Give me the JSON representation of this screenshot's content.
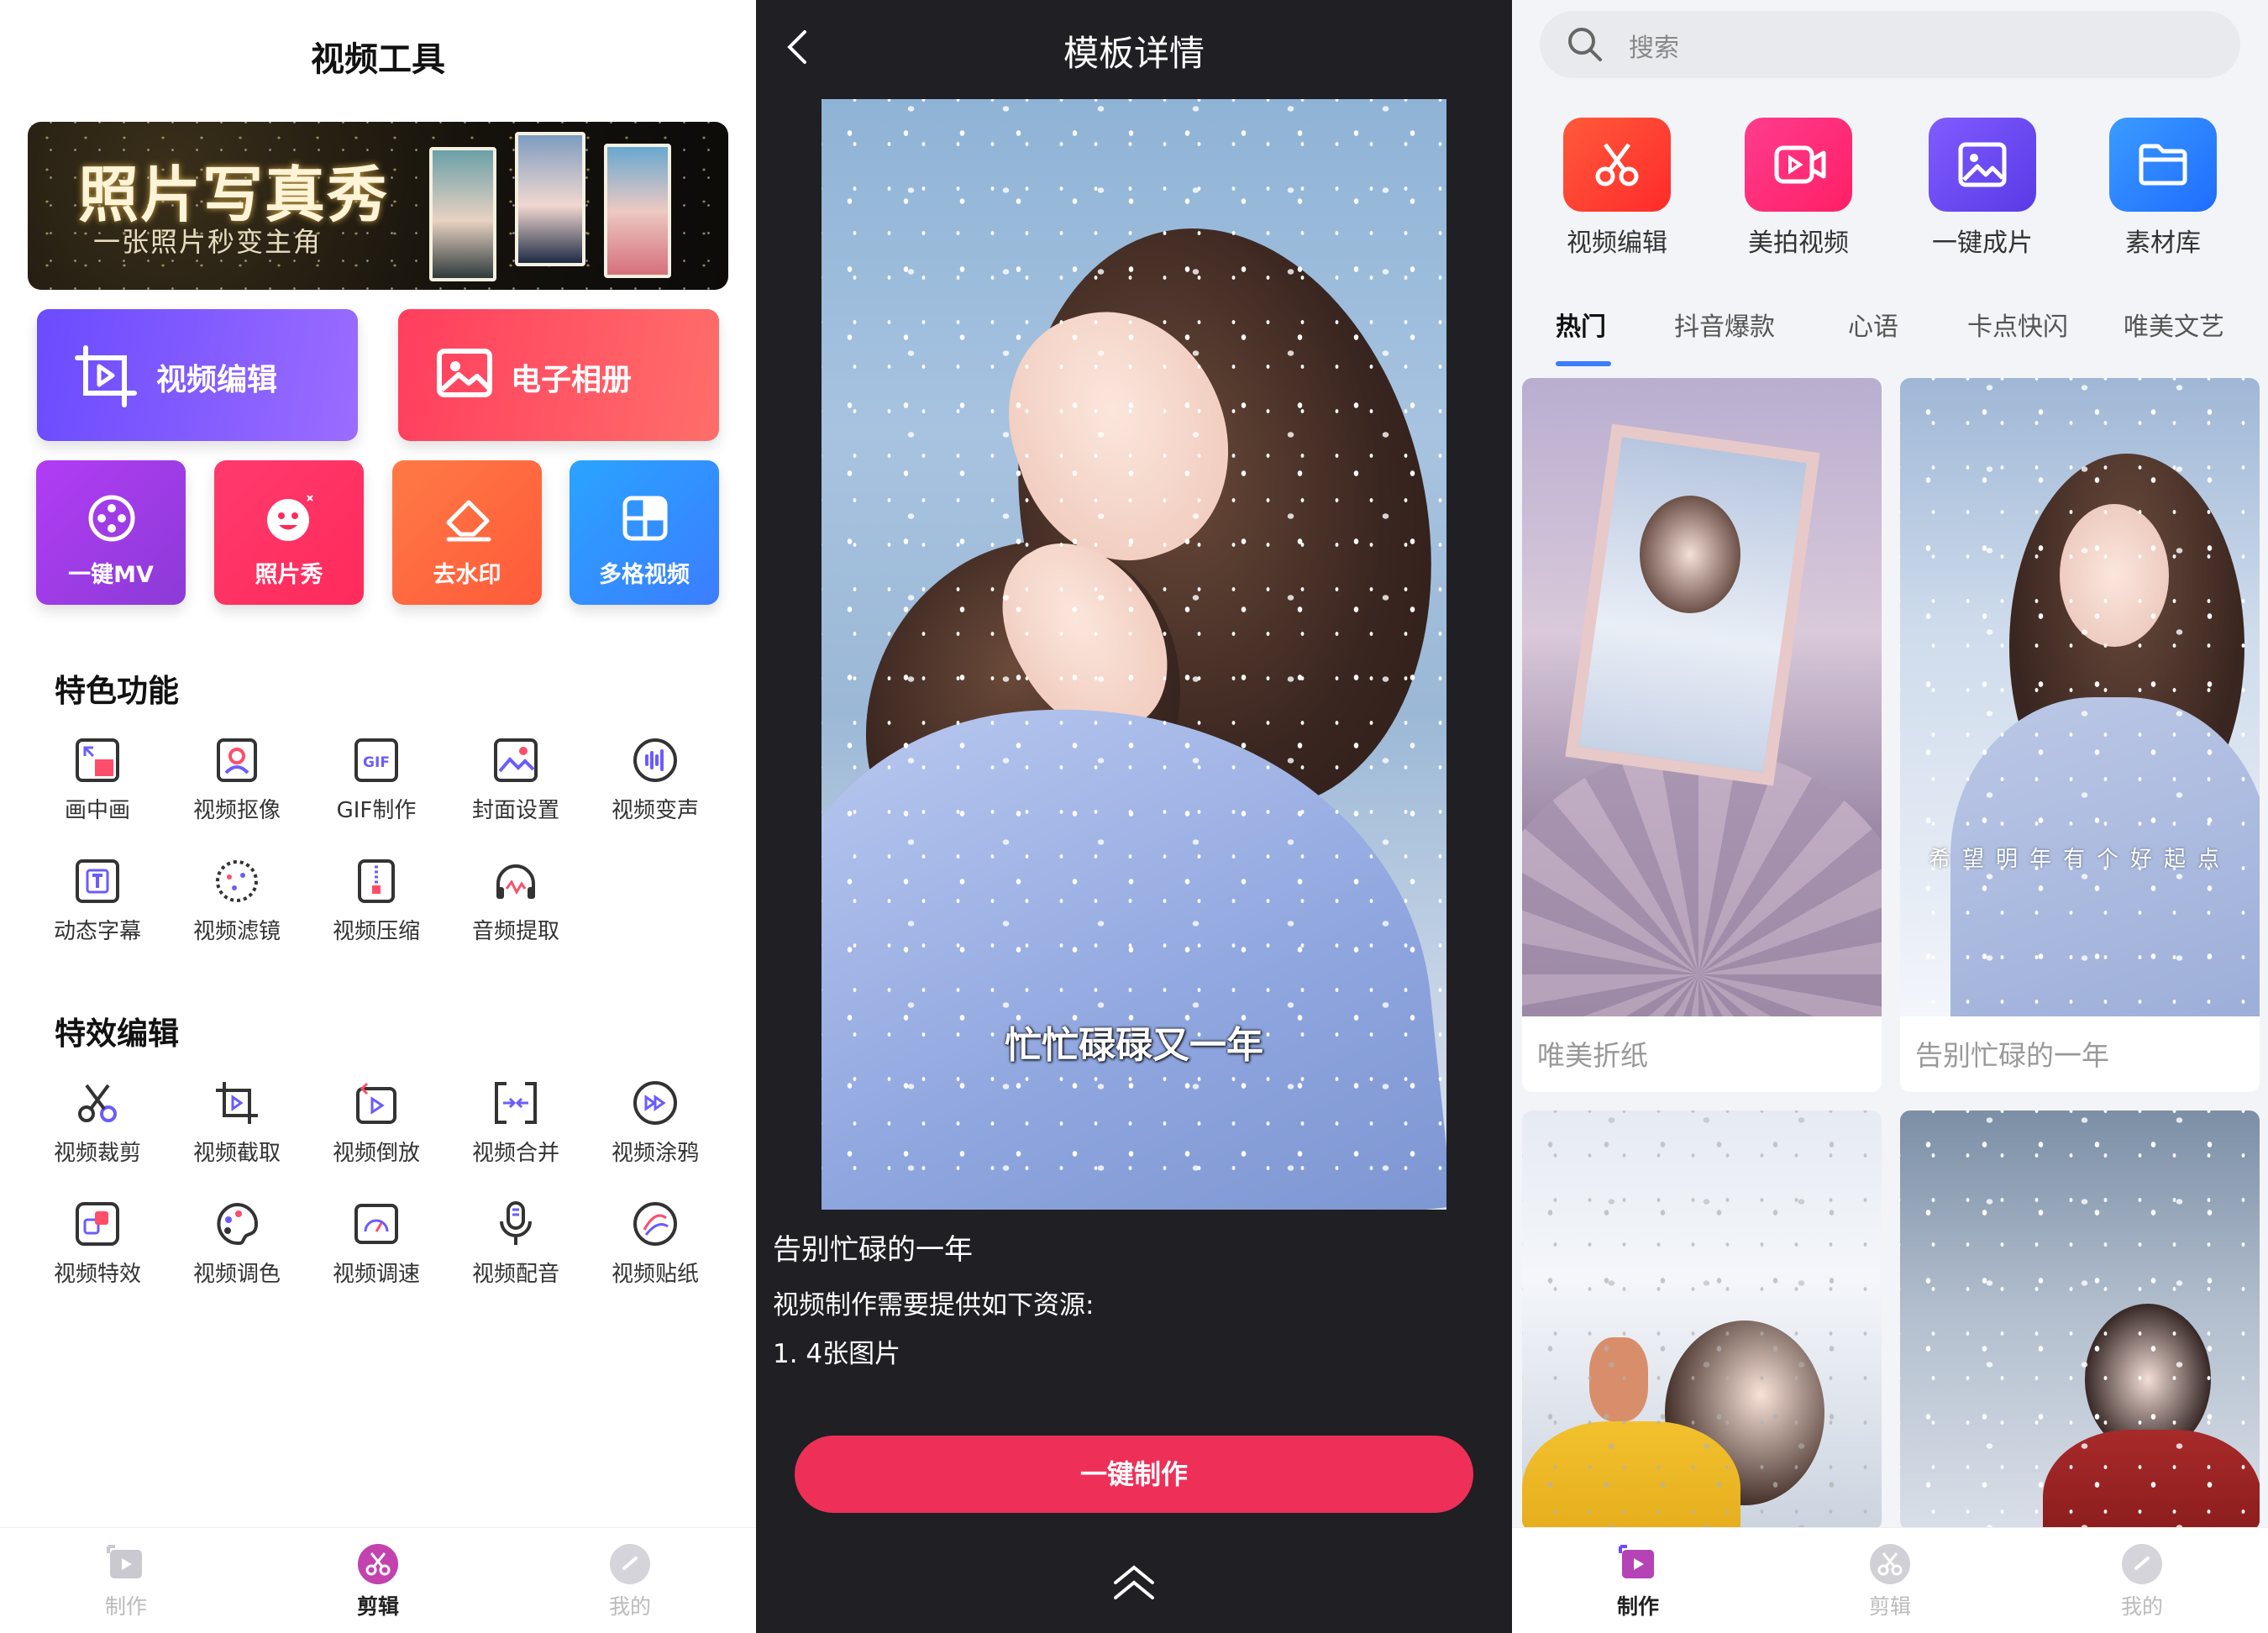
{
  "screen1": {
    "title": "视频工具",
    "banner": {
      "title": "照片写真秀",
      "subtitle": "一张照片秒变主角"
    },
    "big_buttons": [
      {
        "label": "视频编辑",
        "icon": "video-crop-icon"
      },
      {
        "label": "电子相册",
        "icon": "image-icon"
      }
    ],
    "square_buttons": [
      {
        "label": "一键MV",
        "icon": "film-reel-icon"
      },
      {
        "label": "照片秀",
        "icon": "smiley-icon"
      },
      {
        "label": "去水印",
        "icon": "eraser-icon"
      },
      {
        "label": "多格视频",
        "icon": "grid-icon"
      }
    ],
    "section_features": {
      "title": "特色功能",
      "items": [
        "画中画",
        "视频抠像",
        "GIF制作",
        "封面设置",
        "视频变声",
        "动态字幕",
        "视频滤镜",
        "视频压缩",
        "音频提取"
      ]
    },
    "section_effects": {
      "title": "特效编辑",
      "items": [
        "视频裁剪",
        "视频截取",
        "视频倒放",
        "视频合并",
        "视频涂鸦",
        "视频特效",
        "视频调色",
        "视频调速",
        "视频配音",
        "视频贴纸"
      ]
    },
    "tabs": [
      {
        "label": "制作",
        "icon": "make-icon",
        "active": false
      },
      {
        "label": "剪辑",
        "icon": "scissors-icon",
        "active": true
      },
      {
        "label": "我的",
        "icon": "profile-icon",
        "active": false
      }
    ]
  },
  "screen2": {
    "title": "模板详情",
    "preview_caption": "忙忙碌碌又一年",
    "info_title": "告别忙碌的一年",
    "info_lines": [
      "视频制作需要提供如下资源:",
      "1. 4张图片"
    ],
    "make_button": "一键制作"
  },
  "screen3": {
    "search_placeholder": "搜索",
    "apps": [
      {
        "label": "视频编辑",
        "icon": "scissors-icon",
        "color": "#ff3b2f"
      },
      {
        "label": "美拍视频",
        "icon": "video-camera-icon",
        "color": "#ff2d7a"
      },
      {
        "label": "一键成片",
        "icon": "image-icon",
        "color": "#6a4cf5"
      },
      {
        "label": "素材库",
        "icon": "folder-icon",
        "color": "#2f86ff"
      }
    ],
    "categories": [
      "热门",
      "抖音爆款",
      "心语",
      "卡点快闪",
      "唯美文艺"
    ],
    "active_category": "热门",
    "cards": [
      {
        "caption": "唯美折纸"
      },
      {
        "caption": "告别忙碌的一年",
        "overlay": "希望明年有个好起点"
      },
      {
        "caption": ""
      },
      {
        "caption": ""
      }
    ],
    "tabs": [
      {
        "label": "制作",
        "icon": "make-icon",
        "active": true
      },
      {
        "label": "剪辑",
        "icon": "scissors-icon",
        "active": false
      },
      {
        "label": "我的",
        "icon": "profile-icon",
        "active": false
      }
    ]
  },
  "colors": {
    "accent_red": "#ee2f58",
    "accent_blue": "#3b7dff",
    "accent_purple": "#6a4bff"
  }
}
